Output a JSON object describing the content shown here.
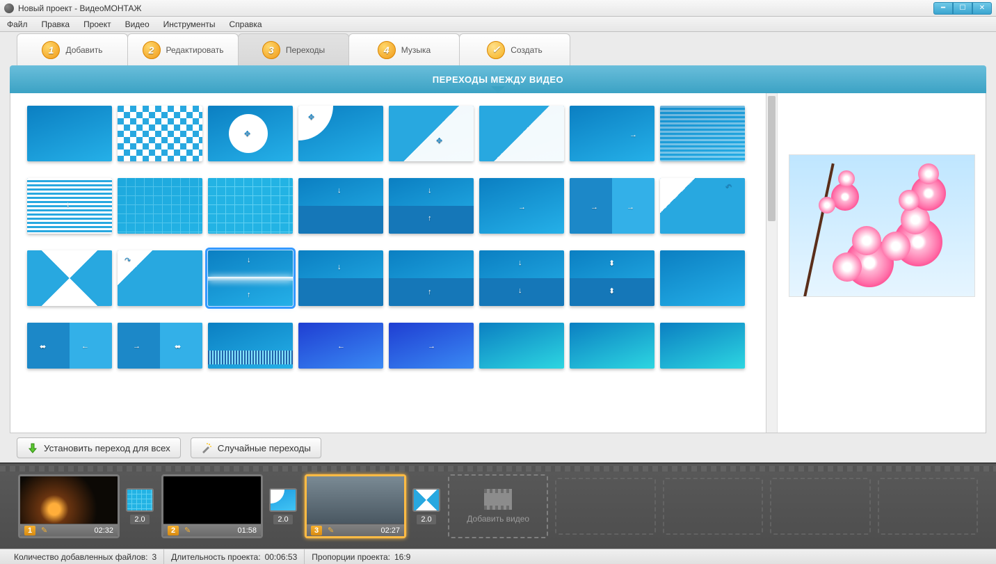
{
  "window": {
    "title": "Новый проект - ВидеоМОНТАЖ"
  },
  "menu": {
    "items": [
      "Файл",
      "Правка",
      "Проект",
      "Видео",
      "Инструменты",
      "Справка"
    ]
  },
  "steps": [
    {
      "num": "1",
      "label": "Добавить"
    },
    {
      "num": "2",
      "label": "Редактировать"
    },
    {
      "num": "3",
      "label": "Переходы"
    },
    {
      "num": "4",
      "label": "Музыка"
    },
    {
      "num": "✓",
      "label": "Создать"
    }
  ],
  "section": {
    "title": "ПЕРЕХОДЫ МЕЖДУ ВИДЕО"
  },
  "actions": {
    "apply_all": "Установить переход для всех",
    "random": "Случайные переходы"
  },
  "timeline": {
    "clips": [
      {
        "index": "1",
        "duration": "02:32"
      },
      {
        "index": "2",
        "duration": "01:58"
      },
      {
        "index": "3",
        "duration": "02:27"
      }
    ],
    "transitions": [
      {
        "duration": "2.0"
      },
      {
        "duration": "2.0"
      },
      {
        "duration": "2.0"
      }
    ],
    "add_label": "Добавить видео"
  },
  "status": {
    "files_label": "Количество добавленных файлов:",
    "files_value": "3",
    "duration_label": "Длительность проекта:",
    "duration_value": "00:06:53",
    "aspect_label": "Пропорции проекта:",
    "aspect_value": "16:9"
  }
}
